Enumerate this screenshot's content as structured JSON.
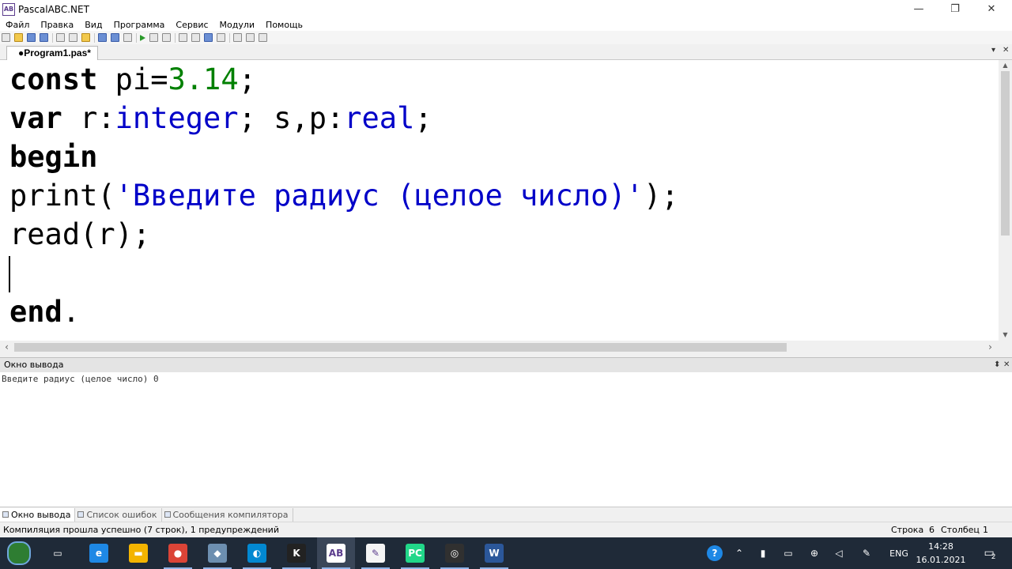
{
  "window": {
    "title": "PascalABC.NET",
    "icon_text": "AB",
    "minimize_icon": "minimize-icon",
    "maximize_icon": "restore-icon",
    "close_icon": "close-icon",
    "min_glyph": "—",
    "max_glyph": "❐",
    "close_glyph": "✕"
  },
  "menu": [
    "Файл",
    "Правка",
    "Вид",
    "Программа",
    "Сервис",
    "Модули",
    "Помощь"
  ],
  "document_tab": {
    "label": "●Program1.pas*",
    "dropdown_glyph": "▾",
    "close_glyph": "✕"
  },
  "editor": {
    "lines": [
      [
        {
          "t": "const",
          "c": "kw"
        },
        {
          "t": " pi=",
          "c": ""
        },
        {
          "t": "3.14",
          "c": "num"
        },
        {
          "t": ";",
          "c": ""
        }
      ],
      [
        {
          "t": "var",
          "c": "kw"
        },
        {
          "t": " r:",
          "c": ""
        },
        {
          "t": "integer",
          "c": "typ"
        },
        {
          "t": "; s,p:",
          "c": ""
        },
        {
          "t": "real",
          "c": "typ"
        },
        {
          "t": ";",
          "c": ""
        }
      ],
      [
        {
          "t": "begin",
          "c": "kw"
        }
      ],
      [
        {
          "t": "print(",
          "c": ""
        },
        {
          "t": "'Введите радиус (целое число)'",
          "c": "str"
        },
        {
          "t": ");",
          "c": ""
        }
      ],
      [
        {
          "t": "read(r);",
          "c": ""
        }
      ],
      [
        {
          "t": "",
          "c": ""
        }
      ],
      [
        {
          "t": "end",
          "c": "kw"
        },
        {
          "t": ".",
          "c": ""
        }
      ]
    ],
    "colors": {
      "keyword": "#000000",
      "number": "#008000",
      "string": "#0000c8",
      "type": "#0000c8"
    }
  },
  "output_panel": {
    "title": "Окно вывода",
    "pin_glyph": "⬍",
    "close_glyph": "✕",
    "text": "Введите радиус (целое число) 0"
  },
  "bottom_tabs": [
    {
      "label": "Окно вывода",
      "active": true
    },
    {
      "label": "Список ошибок",
      "active": false
    },
    {
      "label": "Сообщения компилятора",
      "active": false
    }
  ],
  "status": {
    "message": "Компиляция прошла успешно (7 строк), 1 предупреждений",
    "row_label": "Строка",
    "row_value": "6",
    "col_label": "Столбец",
    "col_value": "1"
  },
  "taskbar": {
    "apps": [
      {
        "name": "start-icon",
        "glyph": "",
        "color": "#2e7d32"
      },
      {
        "name": "task-view-icon",
        "glyph": "▭",
        "color": "transparent"
      },
      {
        "name": "edge-icon",
        "glyph": "e",
        "color": "#1e88e5"
      },
      {
        "name": "explorer-icon",
        "glyph": "▬",
        "color": "#f4b400"
      },
      {
        "name": "chrome-icon",
        "glyph": "●",
        "color": "#db4437"
      },
      {
        "name": "app-icon",
        "glyph": "◆",
        "color": "#6d8fb0"
      },
      {
        "name": "browser-icon",
        "glyph": "◐",
        "color": "#0288d1"
      },
      {
        "name": "k-app-icon",
        "glyph": "K",
        "color": "#222222"
      },
      {
        "name": "pascalabc-icon",
        "glyph": "AB",
        "color": "#ffffff"
      },
      {
        "name": "notes-icon",
        "glyph": "✎",
        "color": "#f5f5f5"
      },
      {
        "name": "pycharm-icon",
        "glyph": "PC",
        "color": "#21d789"
      },
      {
        "name": "obs-icon",
        "glyph": "◎",
        "color": "#303030"
      },
      {
        "name": "word-icon",
        "glyph": "W",
        "color": "#2b579a"
      }
    ],
    "tray": {
      "help_glyph": "?",
      "language": "ENG",
      "time": "14:28",
      "date": "16.01.2021",
      "notification_count": "2"
    }
  }
}
